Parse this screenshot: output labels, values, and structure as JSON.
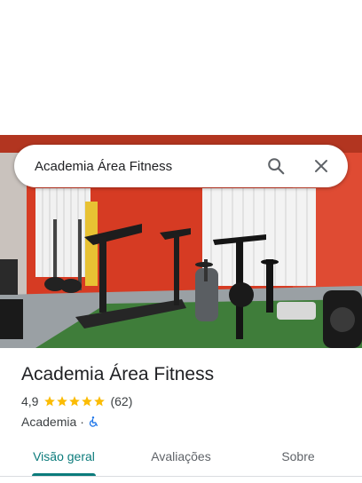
{
  "search": {
    "query": "Academia Área Fitness",
    "search_icon": "search-icon",
    "close_icon": "close-icon"
  },
  "place": {
    "name": "Academia Área Fitness",
    "rating": "4,9",
    "stars": 5,
    "reviews": "(62)",
    "category": "Academia",
    "separator": "·",
    "accessibility_icon": "wheelchair-icon"
  },
  "tabs": [
    {
      "label": "Visão geral",
      "active": true
    },
    {
      "label": "Avaliações",
      "active": false
    },
    {
      "label": "Sobre",
      "active": false
    }
  ],
  "colors": {
    "accent": "#0b7b7b",
    "star": "#fbbc04",
    "accessibility": "#1a73e8",
    "wall": "#d83a22"
  }
}
